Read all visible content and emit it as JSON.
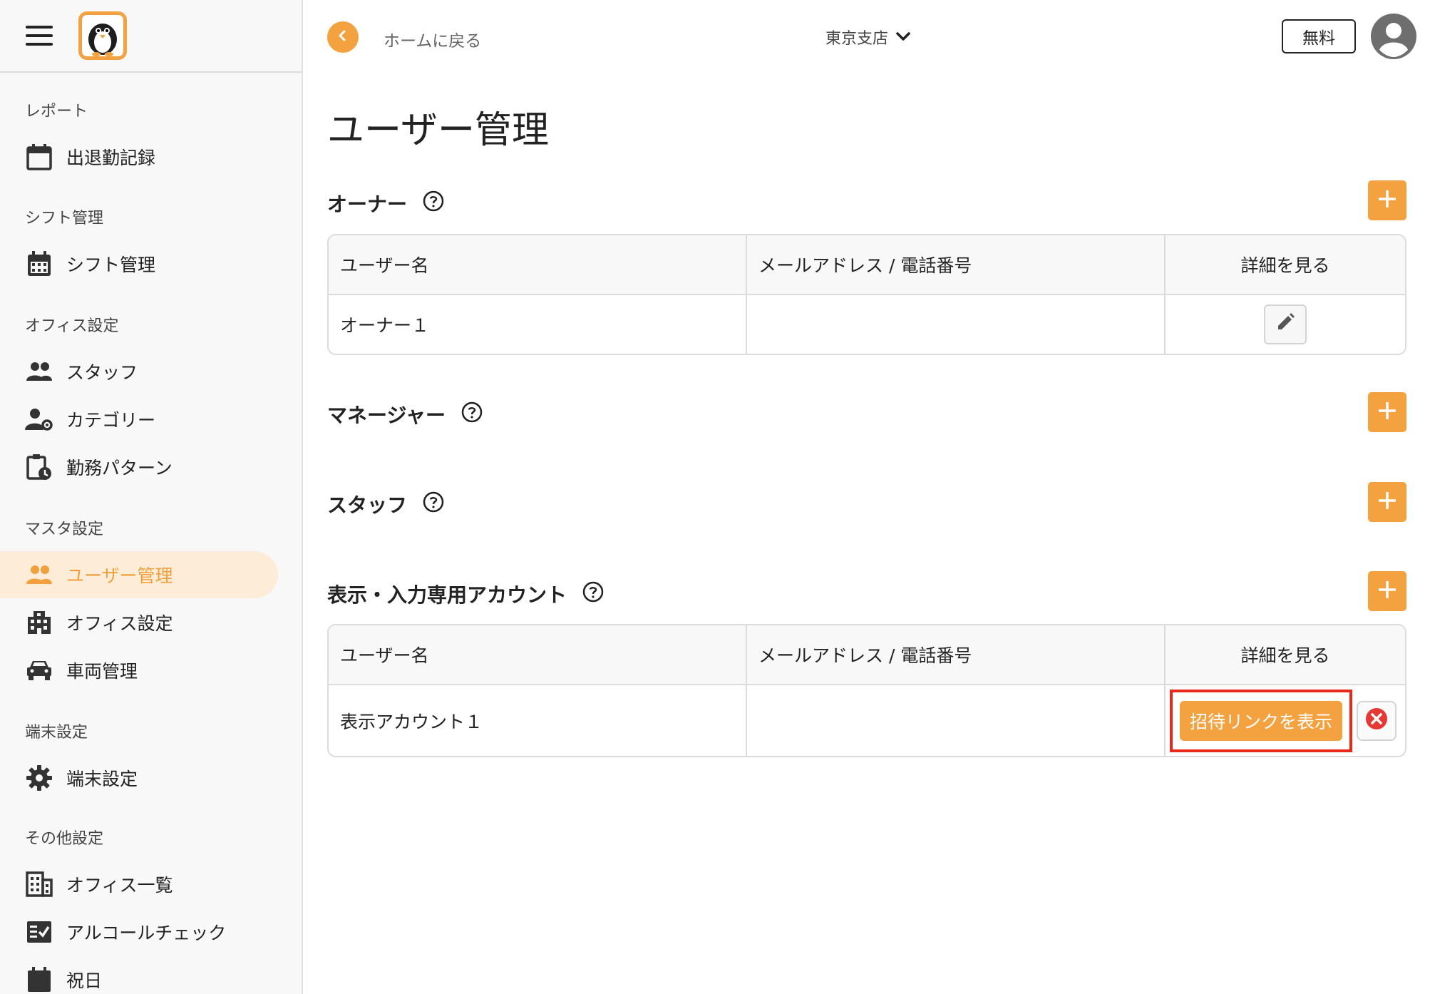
{
  "sidebar": {
    "sections": [
      {
        "label": "レポート",
        "items": [
          {
            "label": "出退勤記録",
            "icon": "calendar-icon"
          }
        ]
      },
      {
        "label": "シフト管理",
        "items": [
          {
            "label": "シフト管理",
            "icon": "calendar-grid-icon"
          }
        ]
      },
      {
        "label": "オフィス設定",
        "items": [
          {
            "label": "スタッフ",
            "icon": "people-icon"
          },
          {
            "label": "カテゴリー",
            "icon": "person-gear-icon"
          },
          {
            "label": "勤務パターン",
            "icon": "clipboard-clock-icon"
          }
        ]
      },
      {
        "label": "マスタ設定",
        "items": [
          {
            "label": "ユーザー管理",
            "icon": "people-icon",
            "active": true
          },
          {
            "label": "オフィス設定",
            "icon": "building-icon"
          },
          {
            "label": "車両管理",
            "icon": "car-icon"
          }
        ]
      },
      {
        "label": "端末設定",
        "items": [
          {
            "label": "端末設定",
            "icon": "gear-icon"
          }
        ]
      },
      {
        "label": "その他設定",
        "items": [
          {
            "label": "オフィス一覧",
            "icon": "building-list-icon"
          },
          {
            "label": "アルコールチェック",
            "icon": "checklist-icon"
          },
          {
            "label": "祝日",
            "icon": "calendar-icon"
          }
        ]
      }
    ]
  },
  "header": {
    "back_label": "ホームに戻る",
    "branch": "東京支店",
    "plan_label": "無料"
  },
  "page": {
    "title": "ユーザー管理",
    "sections": {
      "owner": {
        "title": "オーナー"
      },
      "manager": {
        "title": "マネージャー"
      },
      "staff": {
        "title": "スタッフ"
      },
      "viewer": {
        "title": "表示・入力専用アカウント"
      }
    },
    "table_headers": {
      "username": "ユーザー名",
      "contact": "メールアドレス / 電話番号",
      "details": "詳細を見る"
    },
    "owner_rows": [
      {
        "name": "オーナー１",
        "contact": ""
      }
    ],
    "viewer_rows": [
      {
        "name": "表示アカウント１",
        "contact": "",
        "invite_label": "招待リンクを表示"
      }
    ]
  },
  "colors": {
    "accent": "#f4a240",
    "highlight": "#e8291c"
  }
}
